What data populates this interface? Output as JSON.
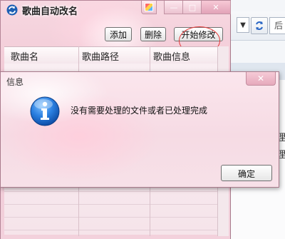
{
  "background_app": {
    "dropdown_arrow": "▼",
    "field_text": "后",
    "fragments": [
      "理",
      "理"
    ]
  },
  "window": {
    "title": "歌曲自动改名",
    "caption": {
      "minimize": "—",
      "maximize": "□",
      "close": "✕"
    },
    "buttons": {
      "add": "添加",
      "delete": "删除",
      "start": "开始修改"
    },
    "columns": [
      "歌曲名",
      "歌曲路径",
      "歌曲信息"
    ]
  },
  "dialog": {
    "title": "信息",
    "close": "✕",
    "message": "没有需要处理的文件或者已处理完成",
    "ok_label": "确定"
  },
  "colors": {
    "highlight_circle": "#e23a3a",
    "info_blue": "#1f6fd1"
  }
}
